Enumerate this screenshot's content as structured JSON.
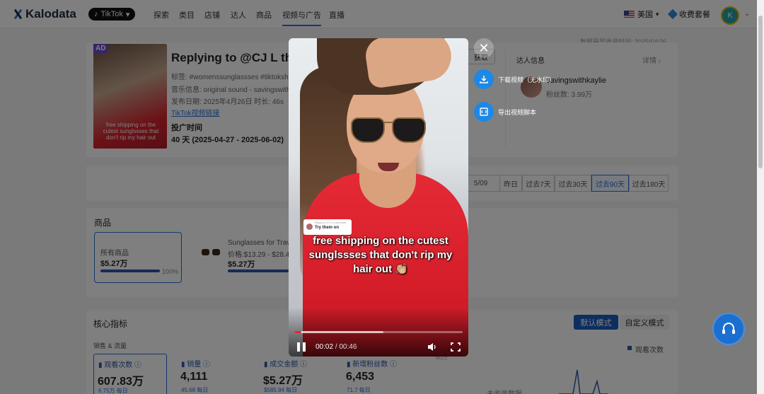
{
  "brand": {
    "name": "Kalodata"
  },
  "nav": {
    "platform": "TikTok",
    "items": [
      "探索",
      "类目",
      "店铺",
      "达人",
      "商品",
      "视频与广告",
      "直播"
    ],
    "region": "美国",
    "pricing": "收费套餐",
    "avatar_letter": "K"
  },
  "page": {
    "data_update": "数据最早收录时间: 2025/04/26",
    "video": {
      "ad_badge": "AD",
      "title": "Replying to @CJ L the",
      "tags": "标签: #womenssunglassses #tiktoksh",
      "music": "音乐信息: original sound - savingswith",
      "publish": "发布日期: 2025年4月26日    时长: 46s",
      "tiktok_link": "TikTok视频链接",
      "ad_time_label": "投广时间",
      "ad_time_value": "40 天 (2025-04-27 - 2025-06-02)",
      "thumb_caption": "free shipping on the cutest sunglssses that don't rip my hair out",
      "edge_button": "获取"
    },
    "creator": {
      "title": "达人信息",
      "detail": "详情",
      "name": "savingswithkaylie",
      "fans": "粉丝数: 3.99万"
    },
    "range": {
      "date_fragment": "5/09",
      "options": [
        "昨日",
        "过去7天",
        "过去30天",
        "过去90天",
        "过去180天"
      ],
      "selected": "过去90天"
    },
    "goods": {
      "title": "商品",
      "all_label": "所有商品",
      "all_value": "$5.27万",
      "all_pct": "100%",
      "all_pct_fraction": 1.0,
      "item_name": "Sunglasses for Trav",
      "item_price": "价格:$13.29 - $28.4",
      "item_value": "$5.27万"
    },
    "metrics": {
      "title": "核心指标",
      "mode_default": "默认模式",
      "mode_custom": "自定义模式",
      "group": "销售 & 流量",
      "legend": "观看次数",
      "axis_tick": "60万",
      "empty_text": "未收录数据",
      "cards": [
        {
          "label": "观看次数",
          "value": "607.83万",
          "sub": "6.75万 每日"
        },
        {
          "label": "销量",
          "value": "4,111",
          "sub": "45.68 每日"
        },
        {
          "label": "成交金额",
          "value": "$5.27万",
          "sub": "$585.94 每日"
        },
        {
          "label": "新增粉丝数",
          "value": "6,453",
          "sub": "71.7 每日"
        }
      ]
    }
  },
  "player": {
    "bubble_reply": "Reply to CJ L's comment",
    "bubble_text": "Try them on",
    "caption": "free shipping on the cutest sunglssses that don't rip my hair out 👏🏼",
    "current_time": "00:02",
    "duration": "00:46",
    "played_fraction": 0.043,
    "buffered_fraction": 0.53,
    "actions": {
      "download": "下载视频（无水印）",
      "export_script": "导出视频脚本"
    }
  },
  "colors": {
    "accent": "#2c6fdb",
    "action_blue": "#1e88e5",
    "progress_red": "#e02a3c"
  }
}
